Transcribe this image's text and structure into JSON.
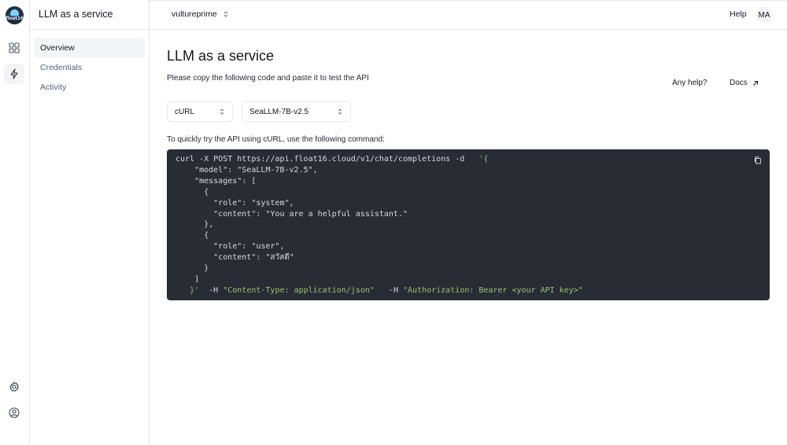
{
  "app": {
    "title": "LLM as a service",
    "logo_text": "float16"
  },
  "header": {
    "org": "vultureprime",
    "help": "Help",
    "avatar": "MA"
  },
  "sidebar": {
    "items": [
      {
        "label": "Overview",
        "active": true
      },
      {
        "label": "Credentials",
        "active": false
      },
      {
        "label": "Activity",
        "active": false
      }
    ]
  },
  "rail": {
    "icons": [
      "grid-icon",
      "bolt-icon",
      "gear-icon",
      "user-circle-icon"
    ]
  },
  "main": {
    "title": "LLM as a service",
    "subtitle": "Please copy the following code and paste it to test the API",
    "any_help": "Any help?",
    "docs": "Docs",
    "language_select": "cURL",
    "model_select": "SeaLLM-7B-v2.5",
    "instruction": "To quickly try the API using cURL, use the following command:",
    "code": {
      "l1_cmd": "curl -X POST https://api.float16.cloud/v1/chat/completions -d   ",
      "l1_quote": "'{",
      "l2": "    \"model\": \"SeaLLM-7B-v2.5\",",
      "l3": "    \"messages\": [",
      "l4": "      {",
      "l5": "        \"role\": \"system\",",
      "l6": "        \"content\": \"You are a helpful assistant.\"",
      "l7": "      },",
      "l8": "      {",
      "l9": "        \"role\": \"user\",",
      "l10": "        \"content\": \"สวัสดี\"",
      "l11": "      }",
      "l12": "    ]",
      "l13_a": "   }'",
      "l13_b": "  -H ",
      "l13_c": "\"Content-Type: application/json\"",
      "l13_d": "   -H ",
      "l13_e": "\"Authorization: Bearer <your API key>\""
    }
  },
  "colors": {
    "code_bg": "#282c34",
    "code_green": "#98c379",
    "nav_text": "#4b5e80",
    "active_bg": "#f3f4f6"
  }
}
